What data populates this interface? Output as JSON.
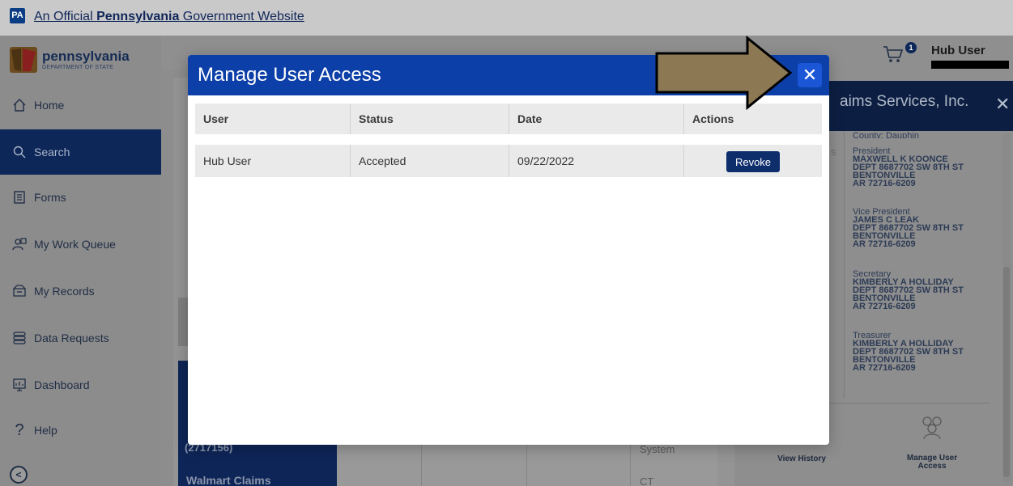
{
  "gov_banner": {
    "badge": "PA",
    "text_before": "An Official ",
    "text_bold": "Pennsylvania",
    "text_after": " Government Website"
  },
  "brand": {
    "name": "pennsylvania",
    "subtitle": "DEPARTMENT OF STATE"
  },
  "sidebar": {
    "items": [
      {
        "label": "Home",
        "icon": "home-icon"
      },
      {
        "label": "Search",
        "icon": "search-icon",
        "active": true
      },
      {
        "label": "Forms",
        "icon": "forms-icon"
      },
      {
        "label": "My Work Queue",
        "icon": "work-queue-icon"
      },
      {
        "label": "My Records",
        "icon": "records-icon"
      },
      {
        "label": "Data Requests",
        "icon": "database-icon"
      },
      {
        "label": "Dashboard",
        "icon": "dashboard-icon"
      },
      {
        "label": "Help",
        "icon": "help-icon"
      }
    ],
    "collapse_glyph": "<"
  },
  "header": {
    "cart_count": "1",
    "user_name": "Hub User"
  },
  "background": {
    "entity_fragment": "(2717156)",
    "entity_row": "Walmart Claims",
    "system_fragment": "System",
    "ct_fragment": "CT",
    "s_fragment": "s"
  },
  "detail_panel": {
    "title_fragment": "aims Services, Inc.",
    "county_fragment": "County: Dauphin",
    "officers": [
      {
        "role": "President",
        "name": "MAXWELL K KOONCE",
        "addr1": "DEPT 8687702 SW 8TH ST",
        "city": "BENTONVILLE",
        "zip": "AR 72716-6209"
      },
      {
        "role": "Vice President",
        "name": "JAMES C LEAK",
        "addr1": "DEPT 8687702 SW 8TH ST",
        "city": "BENTONVILLE",
        "zip": "AR 72716-6209"
      },
      {
        "role": "Secretary",
        "name": "KIMBERLY A HOLLIDAY",
        "addr1": "DEPT 8687702 SW 8TH ST",
        "city": "BENTONVILLE",
        "zip": "AR 72716-6209"
      },
      {
        "role": "Treasurer",
        "name": "KIMBERLY A HOLLIDAY",
        "addr1": "DEPT 8687702 SW 8TH ST",
        "city": "BENTONVILLE",
        "zip": "AR 72716-6209"
      }
    ],
    "actions": {
      "view_history": "View History",
      "manage_access_1": "Manage User",
      "manage_access_2": "Access"
    }
  },
  "modal": {
    "title": "Manage User Access",
    "close_glyph": "✕",
    "columns": [
      "User",
      "Status",
      "Date",
      "Actions"
    ],
    "rows": [
      {
        "user": "Hub User",
        "status": "Accepted",
        "date": "09/22/2022",
        "action": "Revoke"
      }
    ]
  },
  "colors": {
    "modal_header": "#0d3fa8",
    "close_button": "#1a56d6",
    "revoke_button": "#0d2d6b",
    "sidebar_active": "#0d2759",
    "annotation_arrow": "#8c7853"
  }
}
